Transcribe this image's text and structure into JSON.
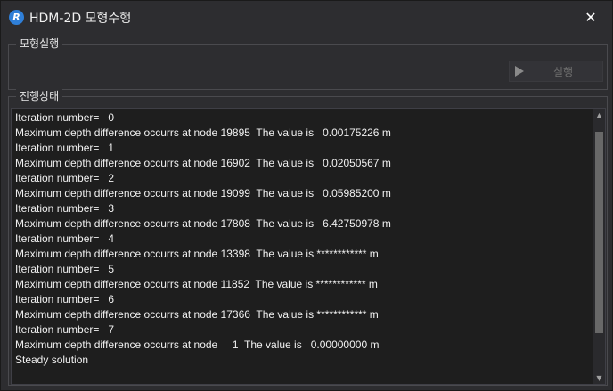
{
  "window": {
    "title": "HDM-2D 모형수행",
    "app_icon_letter": "R",
    "close_glyph": "✕"
  },
  "run_group": {
    "legend": "모형실행",
    "run_button_label": "실행",
    "run_button_enabled": false
  },
  "status_group": {
    "legend": "진행상태",
    "log_lines": [
      "Iteration number=   0",
      "Maximum depth difference occurrs at node 19895  The value is   0.00175226 m",
      "Iteration number=   1",
      "Maximum depth difference occurrs at node 16902  The value is   0.02050567 m",
      "Iteration number=   2",
      "Maximum depth difference occurrs at node 19099  The value is   0.05985200 m",
      "Iteration number=   3",
      "Maximum depth difference occurrs at node 17808  The value is   6.42750978 m",
      "Iteration number=   4",
      "Maximum depth difference occurrs at node 13398  The value is ************ m",
      "Iteration number=   5",
      "Maximum depth difference occurrs at node 11852  The value is ************ m",
      "Iteration number=   6",
      "Maximum depth difference occurrs at node 17366  The value is ************ m",
      "Iteration number=   7",
      "Maximum depth difference occurrs at node     1  The value is   0.00000000 m",
      "Steady solution"
    ]
  },
  "colors": {
    "window_bg": "#2d2d30",
    "log_bg": "#1e1e1e",
    "text": "#f1f1f1",
    "icon_accent": "#2f7fd8"
  }
}
